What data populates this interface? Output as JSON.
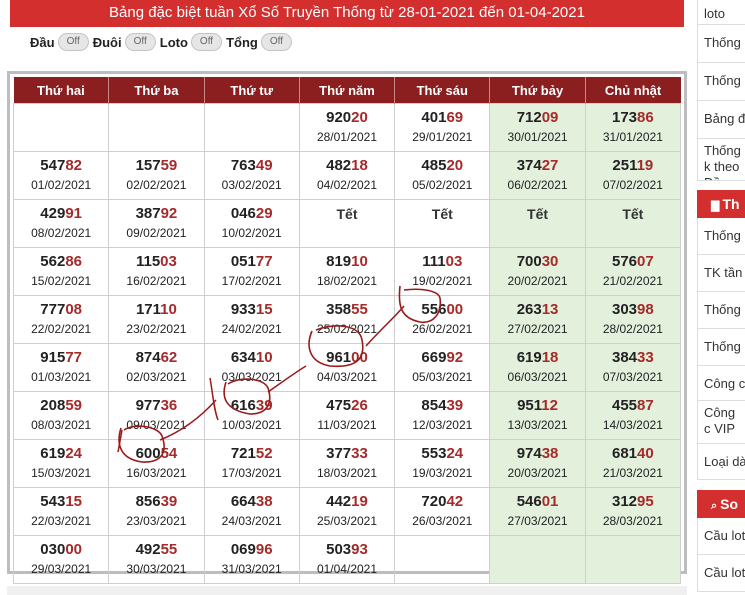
{
  "banner": {
    "title": "Bảng đặc biệt tuần Xổ Số Truyền Thống từ 28-01-2021 đến 01-04-2021"
  },
  "toggles": [
    {
      "label": "Đầu",
      "state": "Off"
    },
    {
      "label": "Đuôi",
      "state": "Off"
    },
    {
      "label": "Loto",
      "state": "Off"
    },
    {
      "label": "Tổng",
      "state": "Off"
    }
  ],
  "weekdays": [
    "Thứ hai",
    "Thứ ba",
    "Thứ tư",
    "Thứ năm",
    "Thứ sáu",
    "Thứ bảy",
    "Chủ nhật"
  ],
  "weeks": [
    [
      null,
      null,
      null,
      {
        "num": "92020",
        "date": "28/01/2021"
      },
      {
        "num": "40169",
        "date": "29/01/2021"
      },
      {
        "num": "71209",
        "date": "30/01/2021"
      },
      {
        "num": "17386",
        "date": "31/01/2021"
      }
    ],
    [
      {
        "num": "54782",
        "date": "01/02/2021"
      },
      {
        "num": "15759",
        "date": "02/02/2021"
      },
      {
        "num": "76349",
        "date": "03/02/2021"
      },
      {
        "num": "48218",
        "date": "04/02/2021"
      },
      {
        "num": "48520",
        "date": "05/02/2021"
      },
      {
        "num": "37427",
        "date": "06/02/2021"
      },
      {
        "num": "25119",
        "date": "07/02/2021"
      }
    ],
    [
      {
        "num": "42991",
        "date": "08/02/2021"
      },
      {
        "num": "38792",
        "date": "09/02/2021"
      },
      {
        "num": "04629",
        "date": "10/02/2021"
      },
      {
        "holiday": "Tết"
      },
      {
        "holiday": "Tết"
      },
      {
        "holiday": "Tết"
      },
      {
        "holiday": "Tết"
      }
    ],
    [
      {
        "num": "56286",
        "date": "15/02/2021"
      },
      {
        "num": "11503",
        "date": "16/02/2021"
      },
      {
        "num": "05177",
        "date": "17/02/2021"
      },
      {
        "num": "81910",
        "date": "18/02/2021"
      },
      {
        "num": "11103",
        "date": "19/02/2021"
      },
      {
        "num": "70030",
        "date": "20/02/2021"
      },
      {
        "num": "57607",
        "date": "21/02/2021"
      }
    ],
    [
      {
        "num": "77708",
        "date": "22/02/2021"
      },
      {
        "num": "17110",
        "date": "23/02/2021"
      },
      {
        "num": "93315",
        "date": "24/02/2021"
      },
      {
        "num": "35855",
        "date": "25/02/2021"
      },
      {
        "num": "55600",
        "date": "26/02/2021"
      },
      {
        "num": "26313",
        "date": "27/02/2021"
      },
      {
        "num": "30398",
        "date": "28/02/2021"
      }
    ],
    [
      {
        "num": "91577",
        "date": "01/03/2021"
      },
      {
        "num": "87462",
        "date": "02/03/2021"
      },
      {
        "num": "63410",
        "date": "03/03/2021"
      },
      {
        "num": "96100",
        "date": "04/03/2021"
      },
      {
        "num": "66992",
        "date": "05/03/2021"
      },
      {
        "num": "61918",
        "date": "06/03/2021"
      },
      {
        "num": "38433",
        "date": "07/03/2021"
      }
    ],
    [
      {
        "num": "20859",
        "date": "08/03/2021"
      },
      {
        "num": "97736",
        "date": "09/03/2021"
      },
      {
        "num": "61639",
        "date": "10/03/2021"
      },
      {
        "num": "47526",
        "date": "11/03/2021"
      },
      {
        "num": "85439",
        "date": "12/03/2021"
      },
      {
        "num": "95112",
        "date": "13/03/2021"
      },
      {
        "num": "45587",
        "date": "14/03/2021"
      }
    ],
    [
      {
        "num": "61924",
        "date": "15/03/2021"
      },
      {
        "num": "60054",
        "date": "16/03/2021"
      },
      {
        "num": "72152",
        "date": "17/03/2021"
      },
      {
        "num": "37733",
        "date": "18/03/2021"
      },
      {
        "num": "55324",
        "date": "19/03/2021"
      },
      {
        "num": "97438",
        "date": "20/03/2021"
      },
      {
        "num": "68140",
        "date": "21/03/2021"
      }
    ],
    [
      {
        "num": "54315",
        "date": "22/03/2021"
      },
      {
        "num": "85639",
        "date": "23/03/2021"
      },
      {
        "num": "66438",
        "date": "24/03/2021"
      },
      {
        "num": "44219",
        "date": "25/03/2021"
      },
      {
        "num": "72042",
        "date": "26/03/2021"
      },
      {
        "num": "54601",
        "date": "27/03/2021"
      },
      {
        "num": "31295",
        "date": "28/03/2021"
      }
    ],
    [
      {
        "num": "03000",
        "date": "29/03/2021"
      },
      {
        "num": "49255",
        "date": "30/03/2021"
      },
      {
        "num": "06996",
        "date": "31/03/2021"
      },
      {
        "num": "50393",
        "date": "01/04/2021"
      },
      null,
      null,
      null
    ]
  ],
  "sidebar": {
    "items_a": [
      "loto",
      "Thống k",
      "Thống k",
      "Bảng đ",
      "Thống k theo Đầ"
    ],
    "head_b": {
      "icon": "bar-chart-icon",
      "label": "Th"
    },
    "items_b": [
      "Thống k",
      "TK tần",
      "Thống k",
      "Thống k",
      "Công c",
      "Công c VIP",
      "Loại dà"
    ],
    "head_c": {
      "icon": "search-icon",
      "label": "So"
    },
    "items_c": [
      "Cầu lot",
      "Cầu lot"
    ]
  },
  "colors": {
    "banner": "#d32f2f",
    "header": "#8b1e1e",
    "weekend": "#e2f0dc",
    "highlight_digits": "#a52a2a",
    "annotation": "#9a1a1a"
  }
}
